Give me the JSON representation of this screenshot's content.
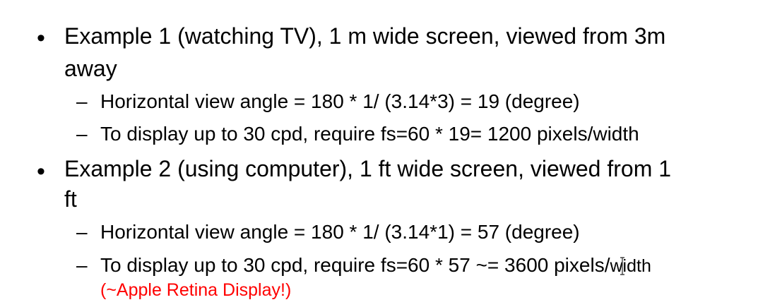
{
  "accent_color": "#ff0000",
  "items": [
    {
      "line1": "Example 1 (watching TV), 1 m wide screen, viewed from 3m",
      "line2": "away",
      "sub": [
        {
          "text": "Horizontal view angle = 180 * 1/ (3.14*3) =   19 (degree)"
        },
        {
          "text": "To display up to 30 cpd, require fs=60 * 19= 1200 pixels/width"
        }
      ]
    },
    {
      "line1": "Example 2 (using computer), 1 ft wide screen, viewed from 1",
      "line2": "ft",
      "sub": [
        {
          "text": "Horizontal view angle = 180 * 1/ (3.14*1) =   57 (degree)"
        },
        {
          "text_main": "To display up to 30 cpd, require fs=60 * 57 ~= 3600 pixels/",
          "text_small": "width",
          "note": "(~Apple Retina Display!)"
        }
      ]
    }
  ],
  "bullet_glyph": "•",
  "dash_glyph": "–"
}
